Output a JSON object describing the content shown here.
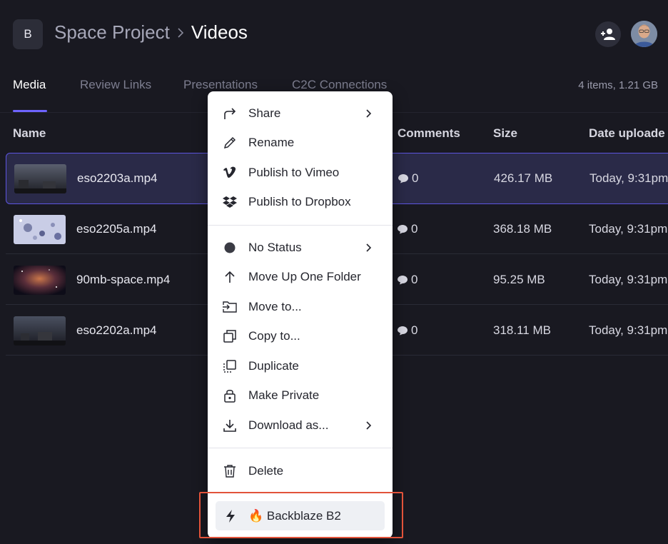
{
  "header": {
    "project_badge": "B",
    "project_name": "Space Project",
    "current_folder": "Videos"
  },
  "tabs": [
    {
      "label": "Media",
      "active": true
    },
    {
      "label": "Review Links",
      "active": false
    },
    {
      "label": "Presentations",
      "active": false
    },
    {
      "label": "C2C Connections",
      "active": false
    }
  ],
  "items_summary": "4 items, 1.21 GB",
  "table": {
    "columns": [
      "Name",
      "Comments",
      "Size",
      "Date uploade"
    ],
    "rows": [
      {
        "name": "eso2203a.mp4",
        "comments": "0",
        "size": "426.17 MB",
        "date": "Today, 9:31pm",
        "selected": true
      },
      {
        "name": "eso2205a.mp4",
        "comments": "0",
        "size": "368.18 MB",
        "date": "Today, 9:31pm",
        "selected": false
      },
      {
        "name": "90mb-space.mp4",
        "comments": "0",
        "size": "95.25 MB",
        "date": "Today, 9:31pm",
        "selected": false
      },
      {
        "name": "eso2202a.mp4",
        "comments": "0",
        "size": "318.11 MB",
        "date": "Today, 9:31pm",
        "selected": false
      }
    ]
  },
  "context_menu": {
    "items": [
      {
        "label": "Share",
        "icon": "share-icon",
        "submenu": true
      },
      {
        "label": "Rename",
        "icon": "pencil-icon",
        "submenu": false
      },
      {
        "label": "Publish to Vimeo",
        "icon": "vimeo-icon",
        "submenu": false
      },
      {
        "label": "Publish to Dropbox",
        "icon": "dropbox-icon",
        "submenu": false
      },
      {
        "label": "No Status",
        "icon": "status-dot-icon",
        "submenu": true
      },
      {
        "label": "Move Up One Folder",
        "icon": "arrow-up-icon",
        "submenu": false
      },
      {
        "label": "Move to...",
        "icon": "folder-move-icon",
        "submenu": false
      },
      {
        "label": "Copy to...",
        "icon": "copy-icon",
        "submenu": false
      },
      {
        "label": "Duplicate",
        "icon": "duplicate-icon",
        "submenu": false
      },
      {
        "label": "Make Private",
        "icon": "lock-icon",
        "submenu": false
      },
      {
        "label": "Download as...",
        "icon": "download-icon",
        "submenu": true
      },
      {
        "label": "Delete",
        "icon": "trash-icon",
        "submenu": false
      }
    ],
    "integration": {
      "label": "🔥 Backblaze B2",
      "icon": "lightning-icon"
    }
  },
  "colors": {
    "background": "#191921",
    "accent": "#6e64ff",
    "highlight_outline": "#e2533a"
  }
}
